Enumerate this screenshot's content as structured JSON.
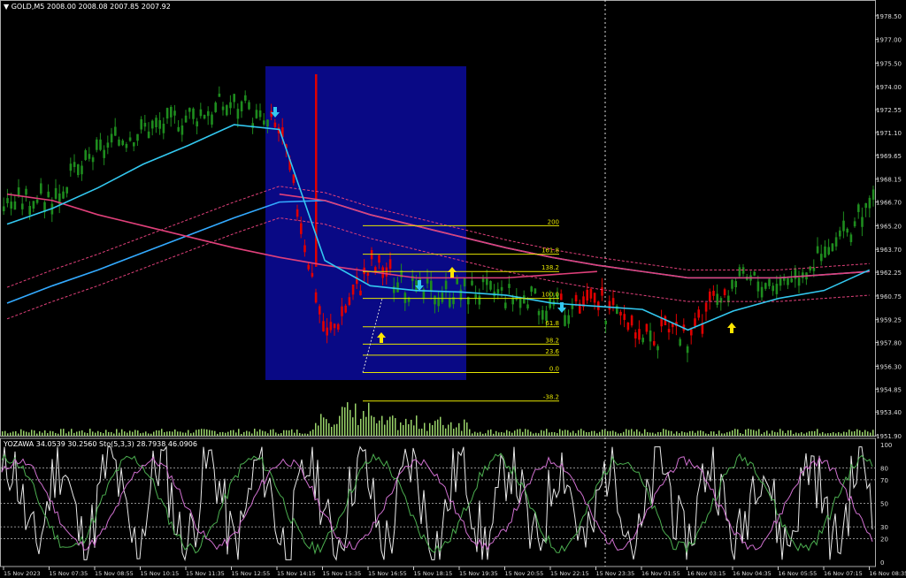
{
  "header": {
    "symbol_label": "GOLD,M5",
    "ohlc_values": "2008.00 2008.08 2007.85 2007.92"
  },
  "indicator_header": {
    "label": "YOZAWA 34.0539 30.2560  Sto(5,3,3) 28.7938 46.0906"
  },
  "colors": {
    "background": "#000000",
    "bull_candle": "#1e8c1e",
    "bear_candle": "#e00000",
    "fast_ma": "#33c8f0",
    "slow_ma": "#33aaff",
    "red_ma": "#e0407a",
    "fib_line": "#e6e600",
    "zone_fill": "#0a0a8c",
    "volume": "#9ad36a",
    "arrow_up": "#ffe600",
    "arrow_down": "#33c8f0"
  },
  "price_axis": {
    "labels": [
      "1978.50",
      "1977.00",
      "1975.50",
      "1974.00",
      "1972.55",
      "1971.10",
      "1969.65",
      "1968.15",
      "1966.70",
      "1965.20",
      "1963.70",
      "1962.25",
      "1960.75",
      "1959.25",
      "1957.80",
      "1956.30",
      "1954.85",
      "1953.40",
      "1951.90"
    ]
  },
  "time_axis": {
    "labels": [
      "15 Nov 2023",
      "15 Nov 07:35",
      "15 Nov 08:55",
      "15 Nov 10:15",
      "15 Nov 11:35",
      "15 Nov 12:55",
      "15 Nov 14:15",
      "15 Nov 15:35",
      "15 Nov 16:55",
      "15 Nov 18:15",
      "15 Nov 19:35",
      "15 Nov 20:55",
      "15 Nov 22:15",
      "15 Nov 23:35",
      "16 Nov 01:55",
      "16 Nov 03:15",
      "16 Nov 04:35",
      "16 Nov 05:55",
      "16 Nov 07:15",
      "16 Nov 08:35"
    ]
  },
  "indicator_axis": {
    "labels": [
      "100",
      "80",
      "70",
      "50",
      "30",
      "20",
      "0"
    ]
  },
  "fib_levels": [
    {
      "label": "200",
      "price": 1965.2
    },
    {
      "label": "161.8",
      "price": 1963.4
    },
    {
      "label": "138.2",
      "price": 1962.3
    },
    {
      "label": "100.0",
      "price": 1960.6
    },
    {
      "label": "61.8",
      "price": 1958.8
    },
    {
      "label": "38.2",
      "price": 1957.7
    },
    {
      "label": "23.6",
      "price": 1957.0
    },
    {
      "label": "0.0",
      "price": 1955.9
    },
    {
      "label": "-38.2",
      "price": 1954.1
    }
  ],
  "chart_data": {
    "type": "candlestick",
    "symbol": "GOLD",
    "timeframe": "M5",
    "y_range": [
      1951.9,
      1979.5
    ],
    "oscillator_range": [
      0,
      100
    ],
    "oscillator_levels": [
      80,
      70,
      50,
      30,
      20
    ],
    "x": [
      "15 Nov 2023",
      "15 Nov 07:35",
      "15 Nov 08:55",
      "15 Nov 10:15",
      "15 Nov 11:35",
      "15 Nov 12:55",
      "15 Nov 14:15",
      "15 Nov 15:35",
      "15 Nov 16:55",
      "15 Nov 18:15",
      "15 Nov 19:35",
      "15 Nov 20:55",
      "15 Nov 22:15",
      "15 Nov 23:35",
      "16 Nov 01:55",
      "16 Nov 03:15",
      "16 Nov 04:35",
      "16 Nov 05:55",
      "16 Nov 07:15",
      "16 Nov 08:35"
    ],
    "close": [
      1966.9,
      1967.3,
      1970.2,
      1971.6,
      1972.4,
      1973.2,
      1971.1,
      1957.9,
      1962.6,
      1961.2,
      1961.4,
      1961.0,
      1960.3,
      1960.2,
      1958.4,
      1957.9,
      1961.9,
      1961.9,
      1963.5,
      1966.7
    ],
    "fast_ma": [
      1965.3,
      1966.3,
      1967.6,
      1969.1,
      1970.3,
      1971.6,
      1971.3,
      1963.0,
      1961.4,
      1961.1,
      1961.0,
      1960.8,
      1960.3,
      1960.1,
      1959.9,
      1958.6,
      1959.8,
      1960.6,
      1961.1,
      1962.4
    ],
    "slow_ma": [
      1960.8,
      1961.9,
      1962.9,
      1964.0,
      1965.1,
      1966.2,
      1967.2,
      1966.8,
      1965.9,
      1965.2,
      1964.5,
      1963.8,
      1963.2,
      1962.7,
      1962.3,
      1961.9,
      1961.9,
      1961.9,
      1962.1,
      1962.3
    ],
    "sell_arrows_at": [
      "15 Nov 14:15",
      "15 Nov 18:15",
      "15 Nov 22:15"
    ],
    "buy_arrows_at": [
      "15 Nov 16:55",
      "15 Nov 19:35",
      "16 Nov 03:15"
    ]
  }
}
